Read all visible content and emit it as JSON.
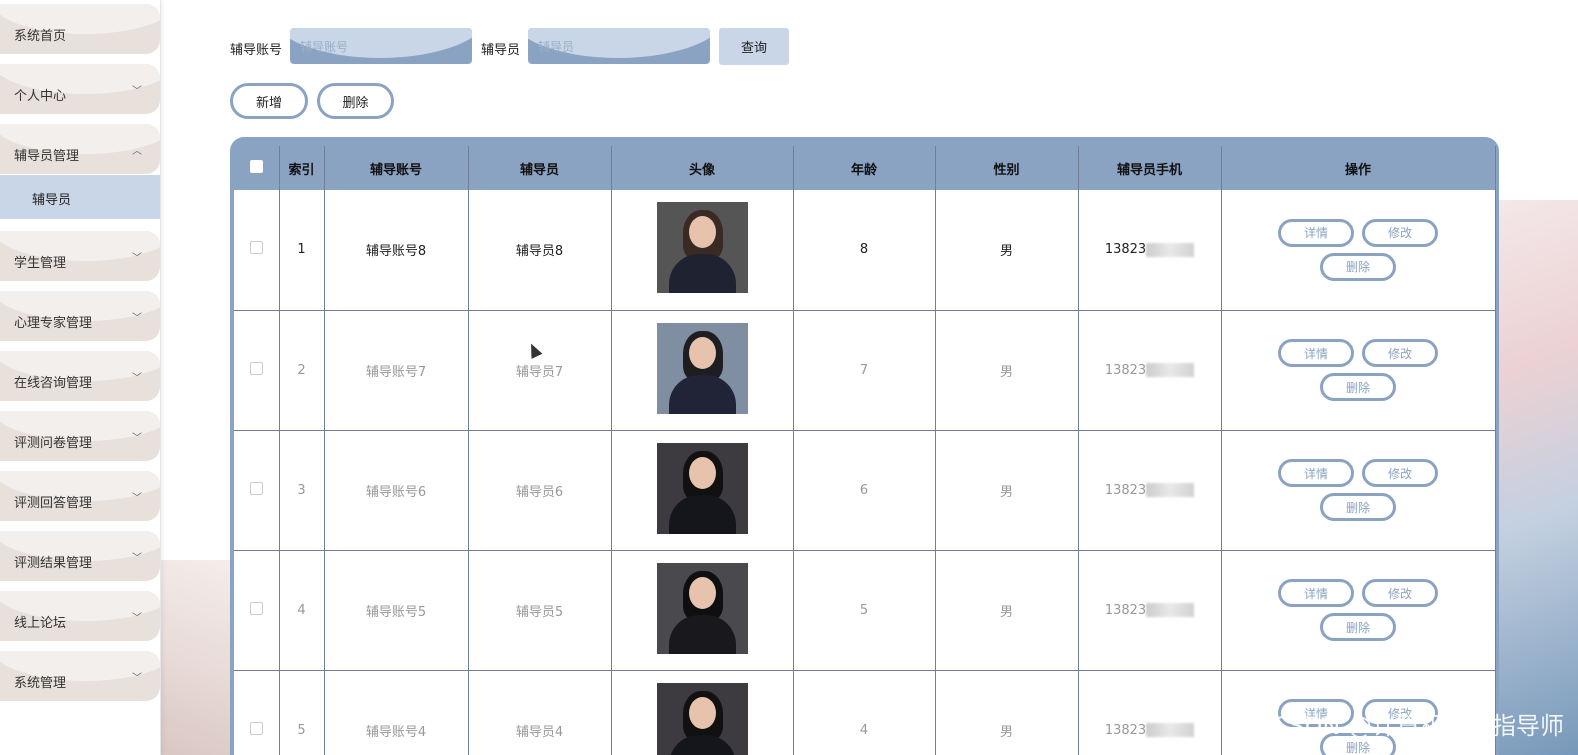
{
  "sidebar": {
    "items": [
      {
        "label": "系统首页",
        "arrow": ""
      },
      {
        "label": "个人中心",
        "arrow": "﹀"
      },
      {
        "label": "辅导员管理",
        "arrow": "︿"
      },
      {
        "label": "学生管理",
        "arrow": "﹀"
      },
      {
        "label": "心理专家管理",
        "arrow": "﹀"
      },
      {
        "label": "在线咨询管理",
        "arrow": "﹀"
      },
      {
        "label": "评测问卷管理",
        "arrow": "﹀"
      },
      {
        "label": "评测回答管理",
        "arrow": "﹀"
      },
      {
        "label": "评测结果管理",
        "arrow": "﹀"
      },
      {
        "label": "线上论坛",
        "arrow": "﹀"
      },
      {
        "label": "系统管理",
        "arrow": "﹀"
      }
    ],
    "sub_active": "辅导员"
  },
  "search": {
    "account_label": "辅导账号",
    "account_placeholder": "辅导账号",
    "name_label": "辅导员",
    "name_placeholder": "辅导员",
    "query_button": "查询"
  },
  "actions": {
    "add": "新增",
    "delete": "删除"
  },
  "table": {
    "headers": [
      "",
      "索引",
      "辅导账号",
      "辅导员",
      "头像",
      "年龄",
      "性别",
      "辅导员手机",
      "操作"
    ],
    "rows": [
      {
        "index": "1",
        "account": "辅导账号8",
        "name": "辅导员8",
        "age": "8",
        "gender": "男",
        "phone": "13823"
      },
      {
        "index": "2",
        "account": "辅导账号7",
        "name": "辅导员7",
        "age": "7",
        "gender": "男",
        "phone": "13823"
      },
      {
        "index": "3",
        "account": "辅导账号6",
        "name": "辅导员6",
        "age": "6",
        "gender": "男",
        "phone": "13823"
      },
      {
        "index": "4",
        "account": "辅导账号5",
        "name": "辅导员5",
        "age": "5",
        "gender": "男",
        "phone": "13823"
      },
      {
        "index": "5",
        "account": "辅导账号4",
        "name": "辅导员4",
        "age": "4",
        "gender": "男",
        "phone": "13823"
      }
    ],
    "row_actions": {
      "detail": "详情",
      "edit": "修改",
      "delete": "删除"
    }
  },
  "watermark": "CSDN @计算机编程指导师"
}
